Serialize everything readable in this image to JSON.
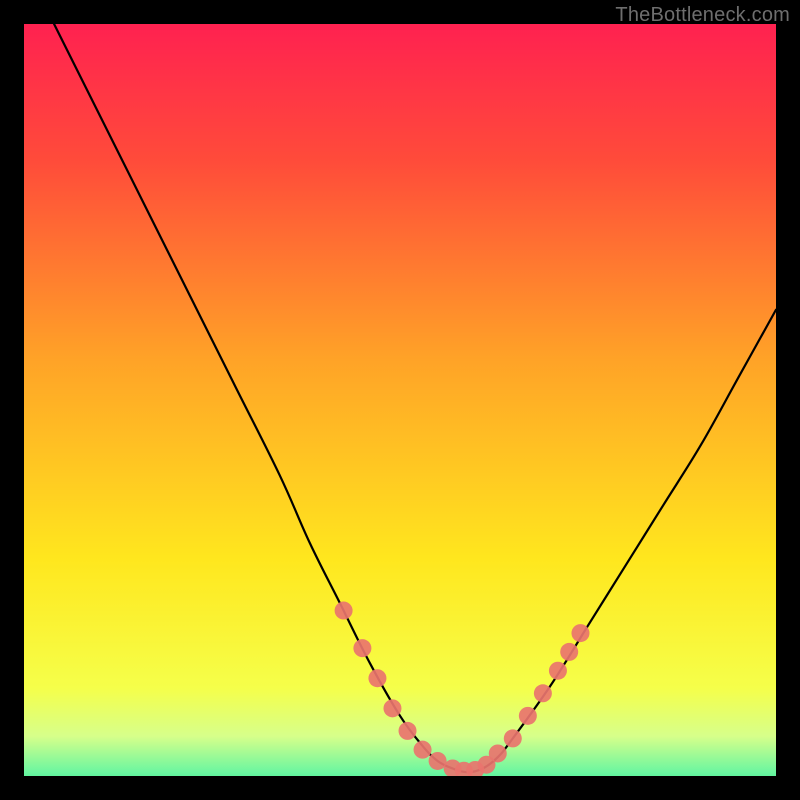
{
  "watermark": "TheBottleneck.com",
  "frame": {
    "border_px": 24,
    "color": "#000000"
  },
  "gradient": {
    "stops": [
      {
        "offset": 0.0,
        "color": "#ff1a54"
      },
      {
        "offset": 0.2,
        "color": "#ff4b3a"
      },
      {
        "offset": 0.45,
        "color": "#ffa327"
      },
      {
        "offset": 0.7,
        "color": "#ffe71e"
      },
      {
        "offset": 0.86,
        "color": "#f5ff4a"
      },
      {
        "offset": 0.92,
        "color": "#d7ff8a"
      },
      {
        "offset": 0.965,
        "color": "#6cf6a0"
      },
      {
        "offset": 1.0,
        "color": "#18e58a"
      }
    ]
  },
  "chart_data": {
    "type": "line",
    "title": "",
    "xlabel": "",
    "ylabel": "",
    "xlim": [
      0,
      100
    ],
    "ylim": [
      0,
      100
    ],
    "series": [
      {
        "name": "curve",
        "x": [
          4,
          10,
          16,
          22,
          28,
          34,
          38,
          42,
          46,
          50,
          53,
          55,
          57,
          59,
          61,
          63,
          65,
          70,
          75,
          80,
          85,
          90,
          95,
          100
        ],
        "y": [
          100,
          88,
          76,
          64,
          52,
          40,
          31,
          23,
          15,
          8,
          4,
          2,
          1,
          0.5,
          1,
          2.5,
          5,
          12,
          20,
          28,
          36,
          44,
          53,
          62
        ]
      }
    ],
    "markers": {
      "name": "sample-points",
      "color": "#e9746e",
      "radius": 9,
      "points": [
        {
          "x": 42.5,
          "y": 22
        },
        {
          "x": 45,
          "y": 17
        },
        {
          "x": 47,
          "y": 13
        },
        {
          "x": 49,
          "y": 9
        },
        {
          "x": 51,
          "y": 6
        },
        {
          "x": 53,
          "y": 3.5
        },
        {
          "x": 55,
          "y": 2
        },
        {
          "x": 57,
          "y": 1
        },
        {
          "x": 58.5,
          "y": 0.7
        },
        {
          "x": 60,
          "y": 0.8
        },
        {
          "x": 61.5,
          "y": 1.5
        },
        {
          "x": 63,
          "y": 3
        },
        {
          "x": 65,
          "y": 5
        },
        {
          "x": 67,
          "y": 8
        },
        {
          "x": 69,
          "y": 11
        },
        {
          "x": 71,
          "y": 14
        },
        {
          "x": 72.5,
          "y": 16.5
        },
        {
          "x": 74,
          "y": 19
        }
      ]
    }
  }
}
